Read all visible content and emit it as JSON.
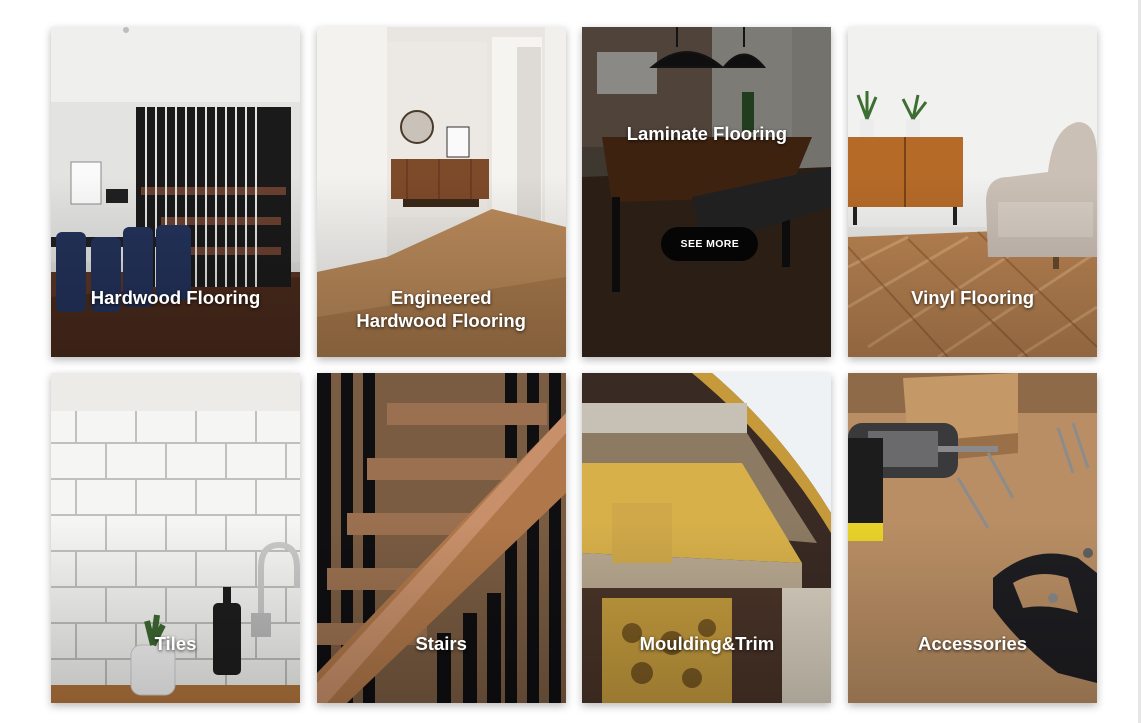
{
  "categories": [
    {
      "title": "Hardwood Flooring"
    },
    {
      "title": "Engineered\nHardwood Flooring"
    },
    {
      "title": "Laminate Flooring",
      "button_label": "SEE MORE"
    },
    {
      "title": "Vinyl Flooring"
    },
    {
      "title": "Tiles"
    },
    {
      "title": "Stairs"
    },
    {
      "title": "Moulding&Trim"
    },
    {
      "title": "Accessories"
    }
  ]
}
